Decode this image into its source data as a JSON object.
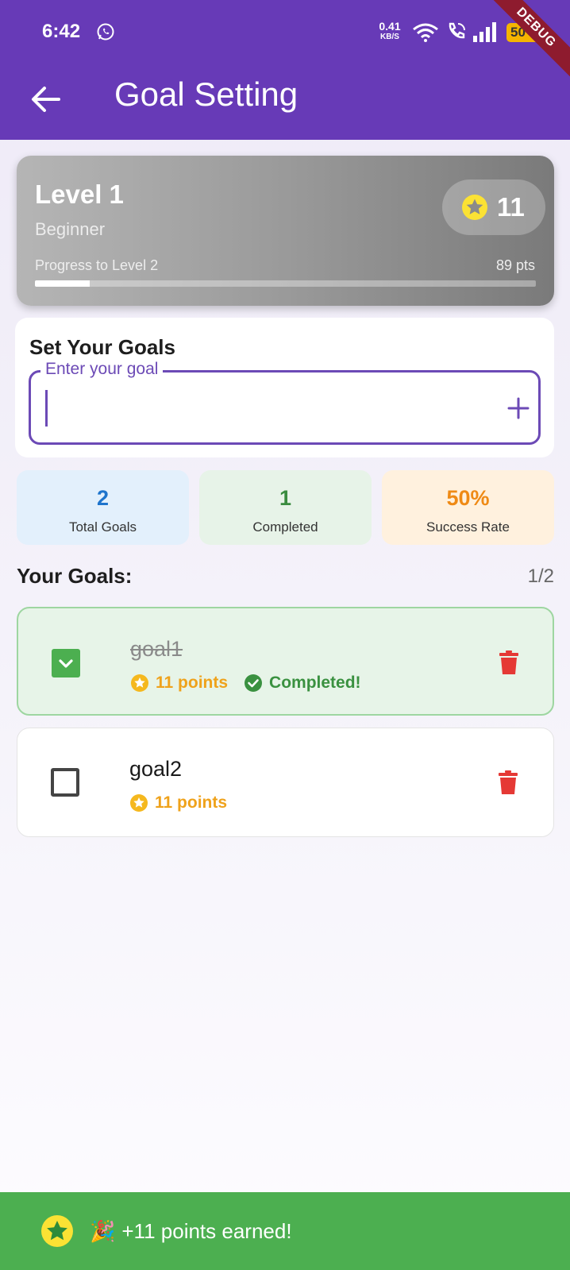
{
  "status_bar": {
    "time": "6:42",
    "net_speed_value": "0.41",
    "net_speed_unit": "KB/S",
    "battery": "50"
  },
  "debug_banner": "DEBUG",
  "app_bar": {
    "title": "Goal Setting"
  },
  "level_card": {
    "level": "Level 1",
    "rank": "Beginner",
    "points": "11",
    "progress_label": "Progress to Level 2",
    "points_remaining": "89 pts",
    "progress_fraction": 0.11
  },
  "goal_input": {
    "heading": "Set Your Goals",
    "label": "Enter your goal",
    "value": ""
  },
  "stats": {
    "total": {
      "value": "2",
      "label": "Total Goals"
    },
    "completed": {
      "value": "1",
      "label": "Completed"
    },
    "success_rate": {
      "value": "50%",
      "label": "Success Rate"
    }
  },
  "goals_list": {
    "title": "Your Goals:",
    "count": "1/2",
    "items": [
      {
        "name": "goal1",
        "points": "11 points",
        "completed": true,
        "completed_label": "Completed!"
      },
      {
        "name": "goal2",
        "points": "11 points",
        "completed": false
      }
    ]
  },
  "snackbar": {
    "emoji": "🎉",
    "message": "+11 points earned!"
  },
  "colors": {
    "primary": "#673AB7",
    "success": "#4CAF50",
    "warning": "#EFA21B",
    "danger": "#E53935",
    "info": "#1E74CC"
  },
  "icons": {
    "back": "arrow-left-icon",
    "star": "star-icon",
    "add": "plus-icon",
    "delete": "trash-icon",
    "check": "check-icon"
  }
}
